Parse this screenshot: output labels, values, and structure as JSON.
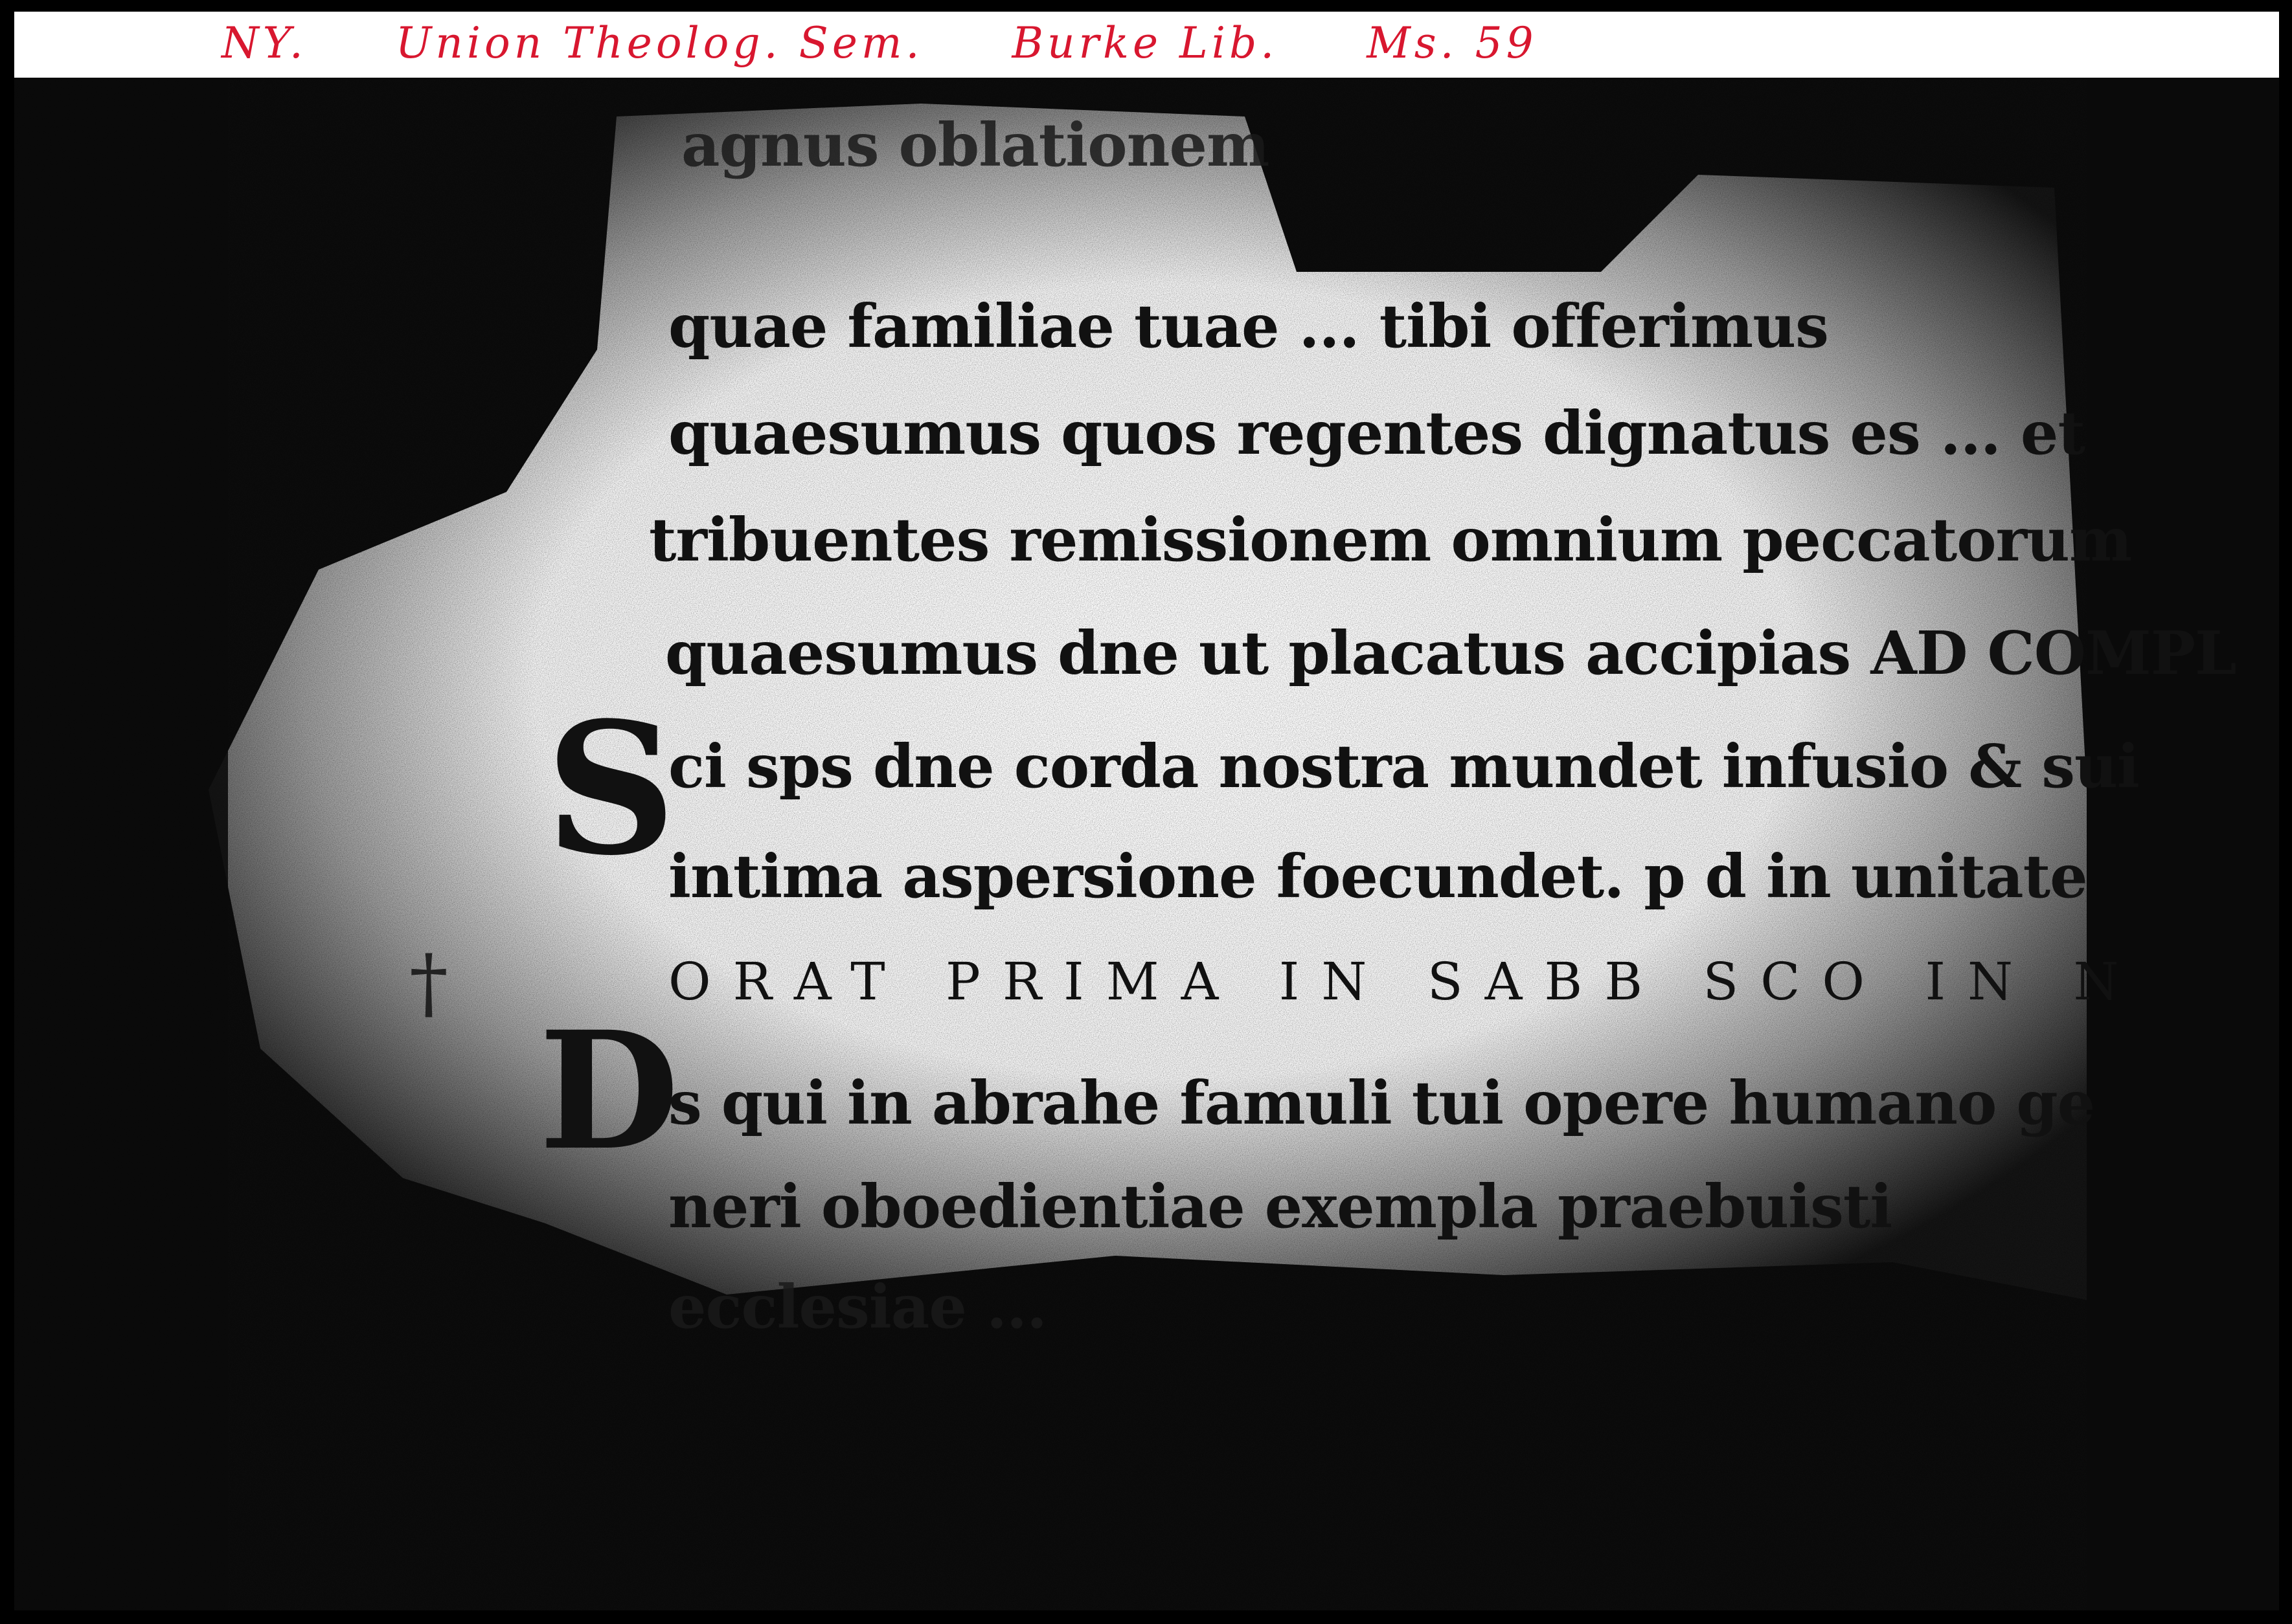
{
  "annotation": {
    "parts": [
      "NY.",
      "Union Theolog. Sem.",
      "Burke Lib.",
      "Ms. 59"
    ]
  },
  "manuscript": {
    "initials": {
      "first": "S",
      "second": "D"
    },
    "margin_mark": "†",
    "lines": [
      "agnus oblationem",
      "quae familiae tuae ... tibi offerimus",
      "quaesumus quos regentes dignatus es ... et",
      "tribuentes remissionem omnium peccatorum",
      "quaesumus dne ut placatus accipias AD COMPL",
      "ci sps dne corda nostra mundet infusio & sui",
      "intima aspersione foecundet. p d in unitate",
      "ORAT PRIMA IN SABB SCO IN N",
      "s qui in abrahe famuli tui opere humano ge",
      "neri oboedientiae exempla praebuisti",
      "ecclesiae ..."
    ]
  },
  "colors": {
    "annotation_ink": "#d8172f",
    "ink": "#111111",
    "background": "#ffffff",
    "frame": "#000000"
  }
}
